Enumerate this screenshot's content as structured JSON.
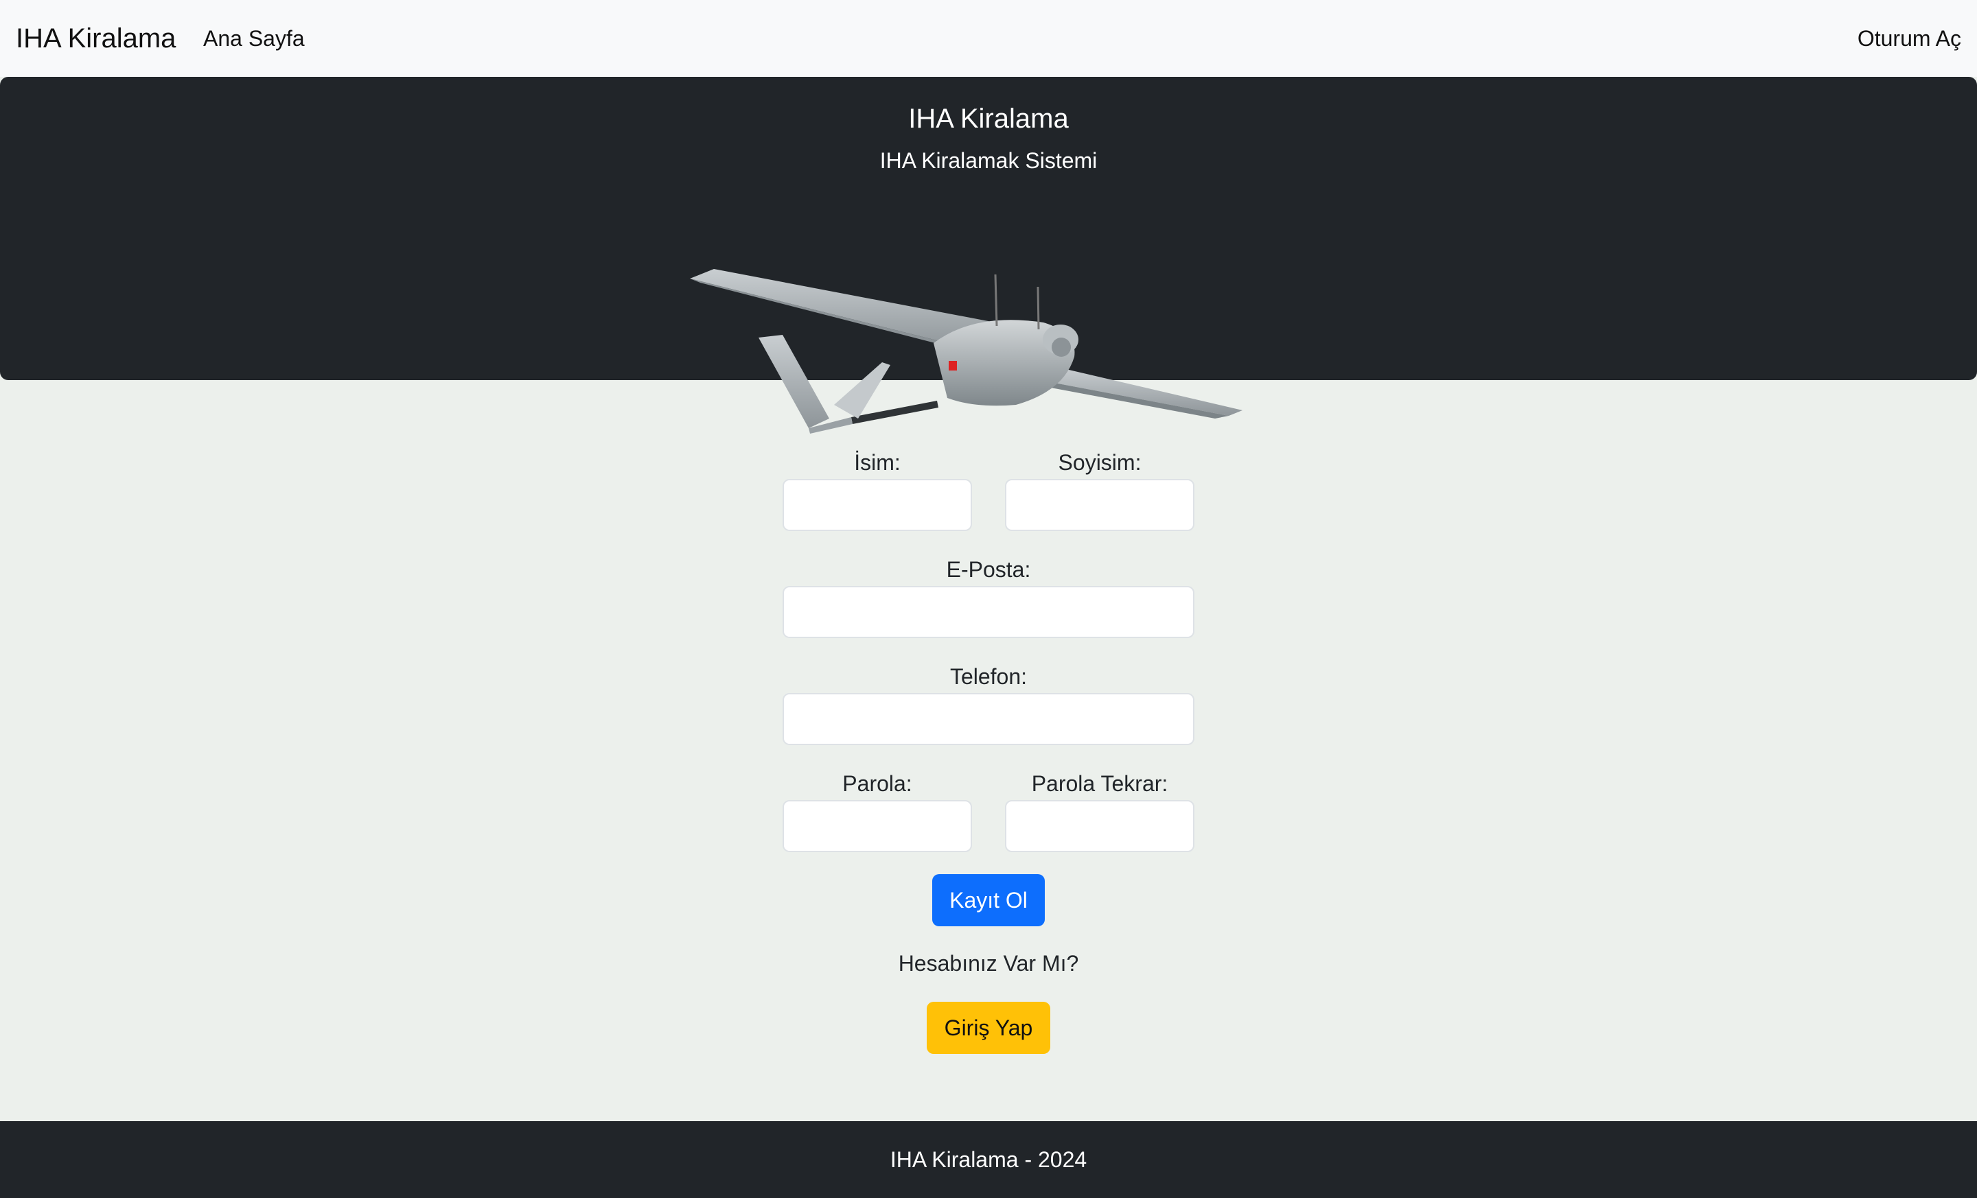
{
  "navbar": {
    "brand": "IHA Kiralama",
    "home_link": "Ana Sayfa",
    "login_link": "Oturum Aç"
  },
  "hero": {
    "title": "IHA Kiralama",
    "subtitle": "IHA Kiralamak Sistemi",
    "image_icon": "drone-uav-image"
  },
  "form": {
    "first_name_label": "İsim:",
    "first_name_value": "",
    "last_name_label": "Soyisim:",
    "last_name_value": "",
    "email_label": "E-Posta:",
    "email_value": "",
    "phone_label": "Telefon:",
    "phone_value": "",
    "password_label": "Parola:",
    "password_value": "",
    "password_repeat_label": "Parola Tekrar:",
    "password_repeat_value": "",
    "register_button": "Kayıt Ol",
    "have_account_text": "Hesabınız Var Mı?",
    "login_button": "Giriş Yap"
  },
  "footer": {
    "text": "IHA Kiralama - 2024"
  },
  "colors": {
    "navbar_bg": "#f8f9fa",
    "dark_bg": "#212529",
    "page_bg": "#ecf0ec",
    "primary": "#0d6efd",
    "warning": "#ffc107"
  }
}
